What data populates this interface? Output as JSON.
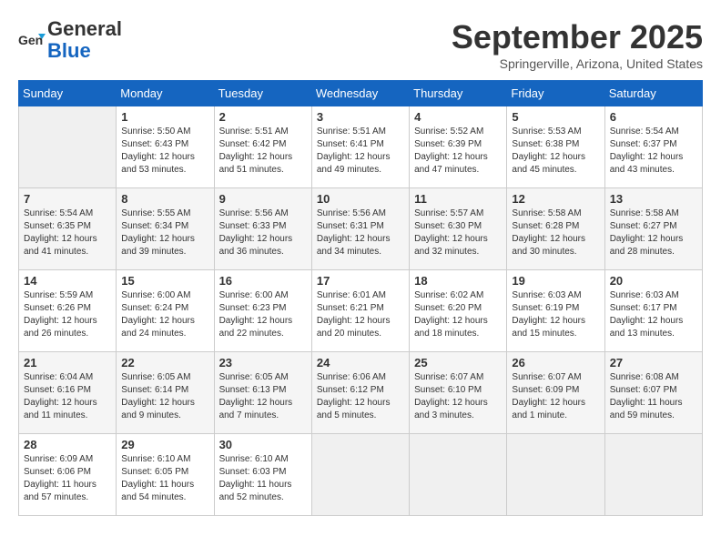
{
  "header": {
    "logo_line1": "General",
    "logo_line2": "Blue",
    "month": "September 2025",
    "location": "Springerville, Arizona, United States"
  },
  "weekdays": [
    "Sunday",
    "Monday",
    "Tuesday",
    "Wednesday",
    "Thursday",
    "Friday",
    "Saturday"
  ],
  "weeks": [
    [
      {
        "day": "",
        "info": ""
      },
      {
        "day": "1",
        "info": "Sunrise: 5:50 AM\nSunset: 6:43 PM\nDaylight: 12 hours\nand 53 minutes."
      },
      {
        "day": "2",
        "info": "Sunrise: 5:51 AM\nSunset: 6:42 PM\nDaylight: 12 hours\nand 51 minutes."
      },
      {
        "day": "3",
        "info": "Sunrise: 5:51 AM\nSunset: 6:41 PM\nDaylight: 12 hours\nand 49 minutes."
      },
      {
        "day": "4",
        "info": "Sunrise: 5:52 AM\nSunset: 6:39 PM\nDaylight: 12 hours\nand 47 minutes."
      },
      {
        "day": "5",
        "info": "Sunrise: 5:53 AM\nSunset: 6:38 PM\nDaylight: 12 hours\nand 45 minutes."
      },
      {
        "day": "6",
        "info": "Sunrise: 5:54 AM\nSunset: 6:37 PM\nDaylight: 12 hours\nand 43 minutes."
      }
    ],
    [
      {
        "day": "7",
        "info": "Sunrise: 5:54 AM\nSunset: 6:35 PM\nDaylight: 12 hours\nand 41 minutes."
      },
      {
        "day": "8",
        "info": "Sunrise: 5:55 AM\nSunset: 6:34 PM\nDaylight: 12 hours\nand 39 minutes."
      },
      {
        "day": "9",
        "info": "Sunrise: 5:56 AM\nSunset: 6:33 PM\nDaylight: 12 hours\nand 36 minutes."
      },
      {
        "day": "10",
        "info": "Sunrise: 5:56 AM\nSunset: 6:31 PM\nDaylight: 12 hours\nand 34 minutes."
      },
      {
        "day": "11",
        "info": "Sunrise: 5:57 AM\nSunset: 6:30 PM\nDaylight: 12 hours\nand 32 minutes."
      },
      {
        "day": "12",
        "info": "Sunrise: 5:58 AM\nSunset: 6:28 PM\nDaylight: 12 hours\nand 30 minutes."
      },
      {
        "day": "13",
        "info": "Sunrise: 5:58 AM\nSunset: 6:27 PM\nDaylight: 12 hours\nand 28 minutes."
      }
    ],
    [
      {
        "day": "14",
        "info": "Sunrise: 5:59 AM\nSunset: 6:26 PM\nDaylight: 12 hours\nand 26 minutes."
      },
      {
        "day": "15",
        "info": "Sunrise: 6:00 AM\nSunset: 6:24 PM\nDaylight: 12 hours\nand 24 minutes."
      },
      {
        "day": "16",
        "info": "Sunrise: 6:00 AM\nSunset: 6:23 PM\nDaylight: 12 hours\nand 22 minutes."
      },
      {
        "day": "17",
        "info": "Sunrise: 6:01 AM\nSunset: 6:21 PM\nDaylight: 12 hours\nand 20 minutes."
      },
      {
        "day": "18",
        "info": "Sunrise: 6:02 AM\nSunset: 6:20 PM\nDaylight: 12 hours\nand 18 minutes."
      },
      {
        "day": "19",
        "info": "Sunrise: 6:03 AM\nSunset: 6:19 PM\nDaylight: 12 hours\nand 15 minutes."
      },
      {
        "day": "20",
        "info": "Sunrise: 6:03 AM\nSunset: 6:17 PM\nDaylight: 12 hours\nand 13 minutes."
      }
    ],
    [
      {
        "day": "21",
        "info": "Sunrise: 6:04 AM\nSunset: 6:16 PM\nDaylight: 12 hours\nand 11 minutes."
      },
      {
        "day": "22",
        "info": "Sunrise: 6:05 AM\nSunset: 6:14 PM\nDaylight: 12 hours\nand 9 minutes."
      },
      {
        "day": "23",
        "info": "Sunrise: 6:05 AM\nSunset: 6:13 PM\nDaylight: 12 hours\nand 7 minutes."
      },
      {
        "day": "24",
        "info": "Sunrise: 6:06 AM\nSunset: 6:12 PM\nDaylight: 12 hours\nand 5 minutes."
      },
      {
        "day": "25",
        "info": "Sunrise: 6:07 AM\nSunset: 6:10 PM\nDaylight: 12 hours\nand 3 minutes."
      },
      {
        "day": "26",
        "info": "Sunrise: 6:07 AM\nSunset: 6:09 PM\nDaylight: 12 hours\nand 1 minute."
      },
      {
        "day": "27",
        "info": "Sunrise: 6:08 AM\nSunset: 6:07 PM\nDaylight: 11 hours\nand 59 minutes."
      }
    ],
    [
      {
        "day": "28",
        "info": "Sunrise: 6:09 AM\nSunset: 6:06 PM\nDaylight: 11 hours\nand 57 minutes."
      },
      {
        "day": "29",
        "info": "Sunrise: 6:10 AM\nSunset: 6:05 PM\nDaylight: 11 hours\nand 54 minutes."
      },
      {
        "day": "30",
        "info": "Sunrise: 6:10 AM\nSunset: 6:03 PM\nDaylight: 11 hours\nand 52 minutes."
      },
      {
        "day": "",
        "info": ""
      },
      {
        "day": "",
        "info": ""
      },
      {
        "day": "",
        "info": ""
      },
      {
        "day": "",
        "info": ""
      }
    ]
  ]
}
